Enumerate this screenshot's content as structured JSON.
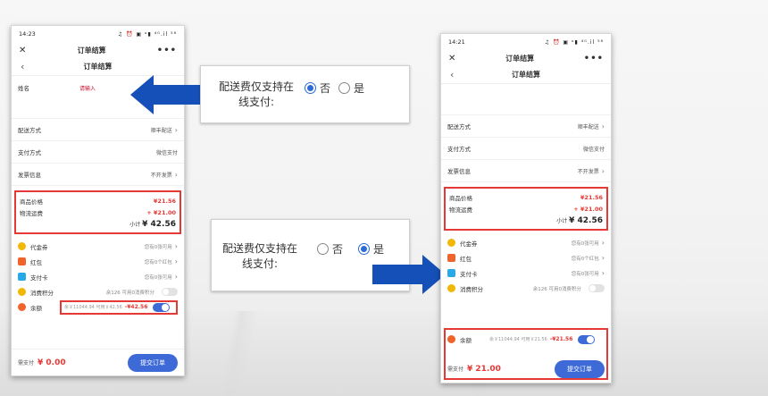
{
  "left_phone": {
    "status_time": "14:23",
    "status_icons": "♫ ⏰ ▣ ᵒ▮ ⁴ᴳ.il ⁵⁸",
    "title": "订单结算",
    "subtitle": "订单结算",
    "name_label": "姓名",
    "name_placeholder": "请输入",
    "rows": [
      {
        "label": "配送方式",
        "value": "顺丰配送"
      },
      {
        "label": "支付方式",
        "value": "微信支付"
      },
      {
        "label": "发票信息",
        "value": "不开发票"
      }
    ],
    "goods_price_label": "商品价格",
    "goods_price": "¥21.56",
    "shipping_label": "物流运费",
    "shipping": "+ ¥21.00",
    "subtotal_label": "小计",
    "subtotal": "¥ 42.56",
    "promos": [
      {
        "label": "代金券",
        "info": "您有0张可用"
      },
      {
        "label": "红包",
        "info": "您有0个红包"
      },
      {
        "label": "支付卡",
        "info": "您有0张可用"
      }
    ],
    "points_label": "消费积分",
    "points_info": "余126 可用0消费积分",
    "balance_label": "余额",
    "balance_info": "余￥11044.94 可用￥42.56",
    "balance_deduct": "-¥42.56",
    "to_pay_label": "需支付",
    "to_pay": "¥ 0.00",
    "submit_label": "提交订单"
  },
  "right_phone": {
    "status_time": "14:21",
    "status_icons": "♫ ⏰ ▣ ᵒ▮ ⁴ᴳ.il ⁵⁸",
    "title": "订单结算",
    "subtitle": "订单结算",
    "rows": [
      {
        "label": "配送方式",
        "value": "顺丰配送"
      },
      {
        "label": "支付方式",
        "value": "微信支付"
      },
      {
        "label": "发票信息",
        "value": "不开发票"
      }
    ],
    "goods_price_label": "商品价格",
    "goods_price": "¥21.56",
    "shipping_label": "物流运费",
    "shipping": "+ ¥21.00",
    "subtotal_label": "小计",
    "subtotal": "¥ 42.56",
    "promos": [
      {
        "label": "代金券",
        "info": "您有0张可用"
      },
      {
        "label": "红包",
        "info": "您有0个红包"
      },
      {
        "label": "支付卡",
        "info": "您有0张可用"
      }
    ],
    "points_label": "消费积分",
    "points_info": "余126 可用0消费积分",
    "balance_label": "余额",
    "balance_info": "余￥11044.94 可用￥21.56",
    "balance_deduct": "-¥21.56",
    "to_pay_label": "需支付",
    "to_pay": "¥ 21.00",
    "submit_label": "提交订单"
  },
  "panel_top": {
    "question": "配送费仅支持在线支付:",
    "option_no": "否",
    "option_yes": "是",
    "selected": "否"
  },
  "panel_bottom": {
    "question": "配送费仅支持在线支付:",
    "option_no": "否",
    "option_yes": "是",
    "selected": "是"
  },
  "colors": {
    "accent_red": "#e53935",
    "button_blue": "#3d6ad6",
    "arrow_blue": "#1550b8"
  }
}
